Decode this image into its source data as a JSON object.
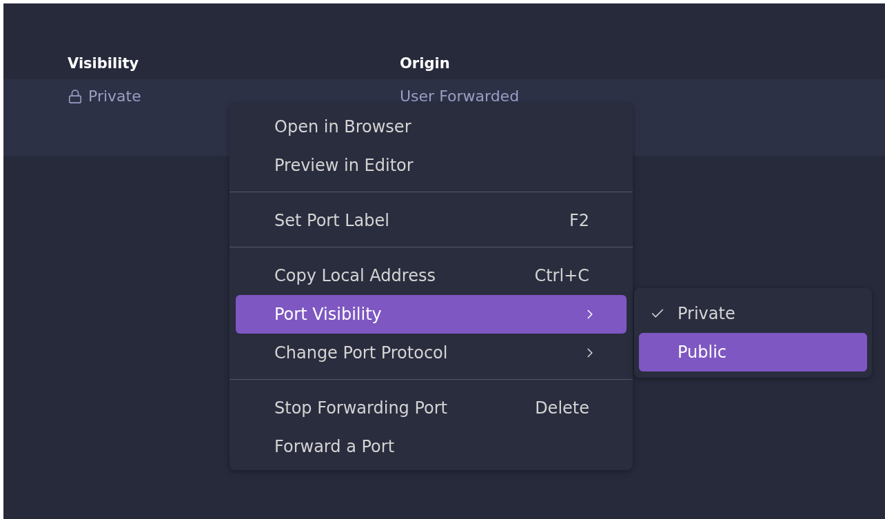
{
  "table": {
    "columns": [
      "Visibility",
      "Origin"
    ],
    "rows": [
      {
        "visibility": "Private",
        "origin": "User Forwarded",
        "selected": true
      }
    ]
  },
  "context_menu": {
    "groups": [
      [
        {
          "label": "Open in Browser",
          "submenu": false,
          "selected": false
        },
        {
          "label": "Preview in Editor",
          "submenu": false,
          "selected": false
        }
      ],
      [
        {
          "label": "Set Port Label",
          "shortcut": "F2",
          "submenu": false,
          "selected": false
        }
      ],
      [
        {
          "label": "Copy Local Address",
          "shortcut": "Ctrl+C",
          "submenu": false,
          "selected": false
        },
        {
          "label": "Port Visibility",
          "submenu": true,
          "selected": true
        },
        {
          "label": "Change Port Protocol",
          "submenu": true,
          "selected": false
        }
      ],
      [
        {
          "label": "Stop Forwarding Port",
          "shortcut": "Delete",
          "submenu": false,
          "selected": false
        },
        {
          "label": "Forward a Port",
          "submenu": false,
          "selected": false
        }
      ]
    ]
  },
  "submenu": {
    "items": [
      {
        "label": "Private",
        "checked": true,
        "selected": false
      },
      {
        "label": "Public",
        "checked": false,
        "selected": true
      }
    ]
  }
}
